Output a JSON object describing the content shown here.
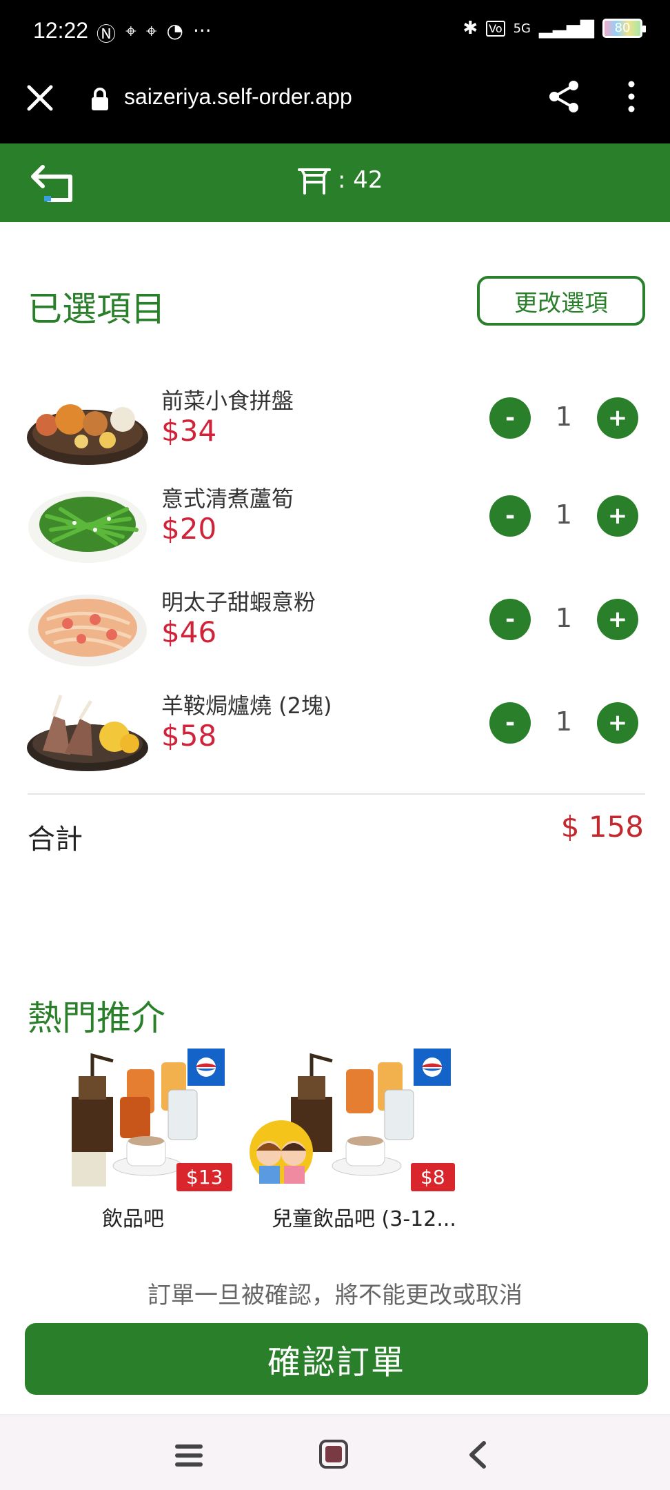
{
  "status_bar": {
    "time": "12:22",
    "network": "5G",
    "battery": "80"
  },
  "browser": {
    "url": "saizeriya.self-order.app"
  },
  "header": {
    "table_label": ": 42"
  },
  "selected": {
    "title": "已選項目",
    "change_button": "更改選項",
    "items": [
      {
        "name": "前菜小食拼盤",
        "price": "$34",
        "qty": "1"
      },
      {
        "name": "意式清煮蘆筍",
        "price": "$20",
        "qty": "1"
      },
      {
        "name": "明太子甜蝦意粉",
        "price": "$46",
        "qty": "1"
      },
      {
        "name": "羊鞍焗爐燒 (2塊)",
        "price": "$58",
        "qty": "1"
      }
    ],
    "minus_label": "-",
    "plus_label": "+",
    "total_label": "合計",
    "total_value": "$ 158"
  },
  "recommend": {
    "title": "熱門推介",
    "items": [
      {
        "name": "飲品吧",
        "price": "$13"
      },
      {
        "name": "兒童飲品吧 (3-12...",
        "price": "$8"
      }
    ]
  },
  "notice": "訂單一旦被確認，將不能更改或取消",
  "confirm_button": "確認訂單",
  "colors": {
    "brand_green": "#2a7f2a",
    "price_red": "#d0233a"
  }
}
